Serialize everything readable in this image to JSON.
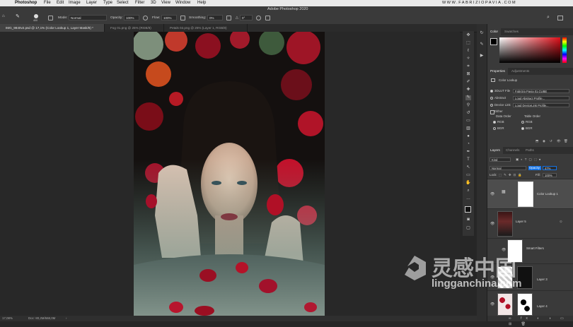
{
  "menubar": {
    "app": "Photoshop",
    "items": [
      "File",
      "Edit",
      "Image",
      "Layer",
      "Type",
      "Select",
      "Filter",
      "3D",
      "View",
      "Window",
      "Help"
    ],
    "watermark_url": "WWW.FABRIZIOPAVIA.COM"
  },
  "window_title": "Adobe Photoshop 2020",
  "options": {
    "brush_size": "400",
    "mode_label": "Mode:",
    "mode_value": "Normal",
    "opacity_label": "Opacity:",
    "opacity_value": "100%",
    "flow_label": "Flow:",
    "flow_value": "100%",
    "smoothing_label": "Smoothing:",
    "smoothing_value": "0%",
    "angle_value": "0°"
  },
  "tabs": [
    {
      "label": "IMG_9840v2.psd @ 17,1% (Color Lookup 1, Layer Mask/8) *",
      "active": true
    },
    {
      "label": "Fog 01.png @ 25% (RGB/8)",
      "active": false
    },
    {
      "label": "Petals 02.png @ 25% (Layer 1, RGB/8)",
      "active": false
    }
  ],
  "status": {
    "zoom": "17,08%",
    "doc": "Doc: 80,2M/668,0M"
  },
  "color_panel": {
    "tabs": [
      "Color",
      "Swatches"
    ]
  },
  "properties_panel": {
    "tabs": [
      "Properties",
      "Adjustments"
    ],
    "title": "Color Lookup",
    "rows": [
      {
        "label": "3DLUT File",
        "value": "Fabrizio Pavia 01.CUBE",
        "selected": true
      },
      {
        "label": "Abstract",
        "value": "Load Abstract Profile...",
        "selected": false
      },
      {
        "label": "Device Link",
        "value": "Load DeviceLink Profile...",
        "selected": false
      }
    ],
    "dither_label": "Dither",
    "data_order_label": "Data Order",
    "table_order_label": "Table Order",
    "data_order": [
      "RGB",
      "BGR"
    ],
    "table_order": [
      "RGB",
      "BGR"
    ]
  },
  "layers_panel": {
    "tabs": [
      "Layers",
      "Channels",
      "Paths"
    ],
    "kind_label": "Kind",
    "blend_mode": "Normal",
    "opacity_label": "Opacity:",
    "opacity_value": "47%",
    "lock_label": "Lock:",
    "fill_label": "Fill:",
    "fill_value": "100%",
    "layers": [
      {
        "name": "Color Lookup 1",
        "type": "adjustment"
      },
      {
        "name": "Layer 5",
        "type": "smart"
      },
      {
        "name": "Smart Filters",
        "type": "filters"
      },
      {
        "name": "Layer 3",
        "type": "mask"
      },
      {
        "name": "Layer 4",
        "type": "mask"
      }
    ]
  },
  "watermark": {
    "brand": "灵感中国",
    "url": "lingganchina.com"
  },
  "colors": {
    "accent": "#1473e6",
    "menubar_bg": "#e9e9e9",
    "panel_bg": "#3a3a3a",
    "canvas_bg": "#282828"
  }
}
